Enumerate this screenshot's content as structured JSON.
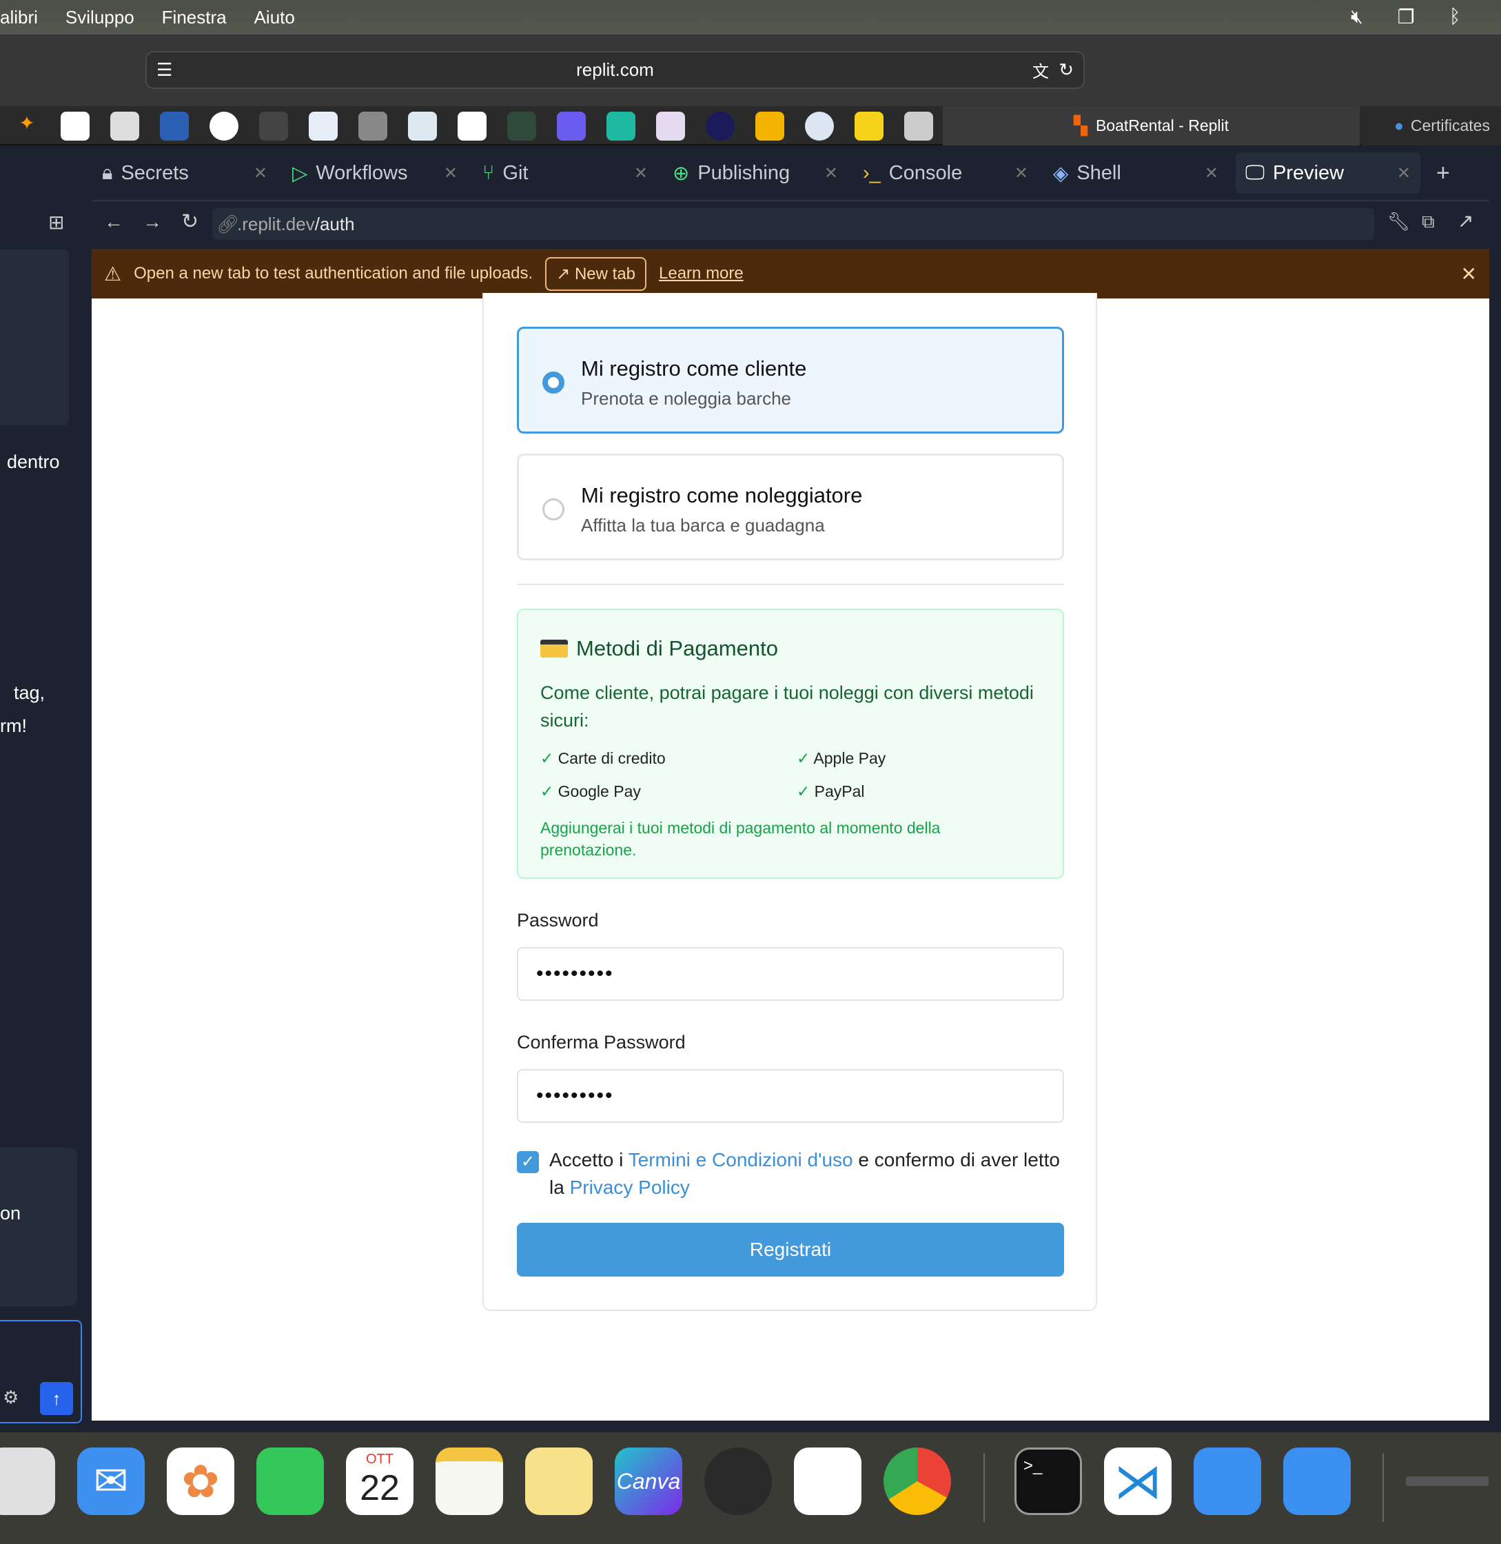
{
  "menubar": {
    "items": [
      "alibri",
      "Sviluppo",
      "Finestra",
      "Aiuto"
    ]
  },
  "browser": {
    "url": "replit.com",
    "active_tab": "BoatRental - Replit",
    "other_tab": "Certificates"
  },
  "replit_tabs": [
    {
      "label": "Secrets",
      "icon": "lock-icon"
    },
    {
      "label": "Workflows",
      "icon": "play-icon"
    },
    {
      "label": "Git",
      "icon": "git-icon"
    },
    {
      "label": "Publishing",
      "icon": "publish-icon"
    },
    {
      "label": "Console",
      "icon": "terminal-icon"
    },
    {
      "label": "Shell",
      "icon": "shell-icon"
    },
    {
      "label": "Preview",
      "icon": "monitor-icon"
    }
  ],
  "preview": {
    "url_prefix": ".replit.dev",
    "url_path": "/auth"
  },
  "banner": {
    "text": "Open a new tab to test authentication and file uploads.",
    "new_tab": "New tab",
    "learn_more": "Learn more"
  },
  "sidebar": {
    "snippets": [
      "dentro",
      "tag,",
      "rm!",
      "on"
    ]
  },
  "form": {
    "option_client": {
      "title": "Mi registro come cliente",
      "subtitle": "Prenota e noleggia barche",
      "selected": true
    },
    "option_renter": {
      "title": "Mi registro come noleggiatore",
      "subtitle": "Affitta la tua barca e guadagna",
      "selected": false
    },
    "payment": {
      "title": "Metodi di Pagamento",
      "desc": "Come cliente, potrai pagare i tuoi noleggi con diversi metodi sicuri:",
      "methods": [
        "Carte di credito",
        "Apple Pay",
        "Google Pay",
        "PayPal"
      ],
      "note": "Aggiungerai i tuoi metodi di pagamento al momento della prenotazione."
    },
    "password_label": "Password",
    "password_value": "•••••••••",
    "confirm_label": "Conferma Password",
    "confirm_value": "•••••••••",
    "terms": {
      "checked": true,
      "pre": "Accetto i ",
      "link1": "Termini e Condizioni d'uso",
      "mid": " e confermo di aver letto la ",
      "link2": "Privacy Policy"
    },
    "submit": "Registrati"
  },
  "dock": {
    "calendar_month": "OTT",
    "calendar_day": "22",
    "canva": "Canva"
  },
  "colors": {
    "accent": "#4299db",
    "banner": "#4c2b0d",
    "payment_bg": "#f0fdf4"
  }
}
